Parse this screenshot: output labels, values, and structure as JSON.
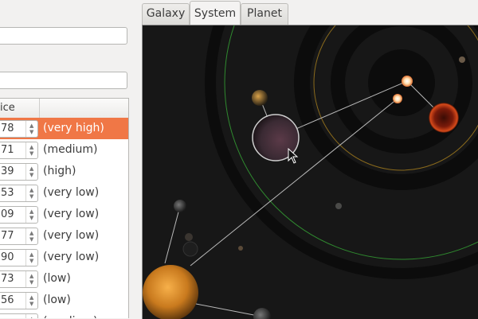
{
  "tabs": [
    {
      "label": "Galaxy"
    },
    {
      "label": "System"
    },
    {
      "label": "Planet"
    }
  ],
  "table": {
    "header_col1": "ice",
    "rows": [
      {
        "value": "78",
        "label": "(very high)",
        "selected": true
      },
      {
        "value": "71",
        "label": "(medium)"
      },
      {
        "value": "39",
        "label": "(high)"
      },
      {
        "value": "53",
        "label": "(very low)"
      },
      {
        "value": "09",
        "label": "(very low)"
      },
      {
        "value": "77",
        "label": "(very low)"
      },
      {
        "value": "90",
        "label": "(very low)"
      },
      {
        "value": "73",
        "label": "(low)"
      },
      {
        "value": "56",
        "label": "(low)"
      },
      {
        "value": "",
        "label": "(medium)"
      }
    ]
  },
  "colors": {
    "selection": "#f07746",
    "canvas_bg": "#171717",
    "orbit_green": "#2f8a2f",
    "orbit_gold": "#8a6a1c"
  },
  "icons": {
    "spin_up": "▲",
    "spin_down": "▼"
  }
}
